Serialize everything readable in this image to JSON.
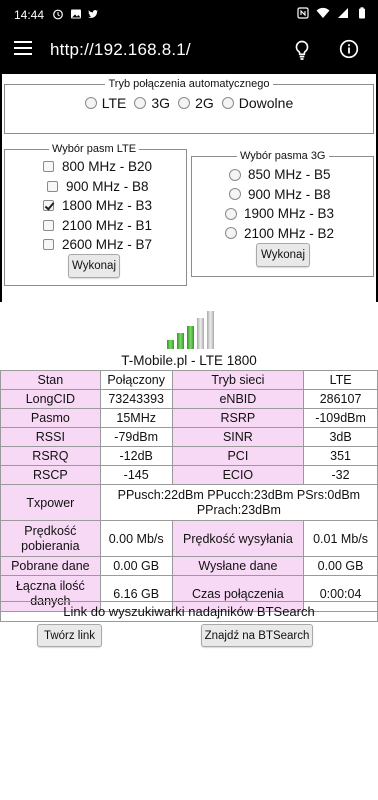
{
  "statusbar": {
    "time": "14:44",
    "left_icons": [
      "alarm-icon",
      "image-icon",
      "twitter-icon"
    ],
    "right_icons": [
      "nfc-icon",
      "wifi-icon",
      "cellular-icon",
      "battery-icon"
    ]
  },
  "toolbar": {
    "url": "http://192.168.8.1/",
    "icons": [
      "menu-icon",
      "lightbulb-icon",
      "info-icon"
    ]
  },
  "mode": {
    "legend": "Tryb połączenia automatycznego",
    "options": [
      "LTE",
      "3G",
      "2G",
      "Dowolne"
    ]
  },
  "lte_bands": {
    "legend": "Wybór pasm LTE",
    "items": [
      {
        "label": "800 MHz - B20",
        "checked": false
      },
      {
        "label": "900 MHz - B8",
        "checked": false
      },
      {
        "label": "1800 MHz - B3",
        "checked": true
      },
      {
        "label": "2100 MHz - B1",
        "checked": false
      },
      {
        "label": "2600 MHz - B7",
        "checked": false
      }
    ],
    "button": "Wykonaj"
  },
  "g3_bands": {
    "legend": "Wybór pasma 3G",
    "items": [
      "850 MHz - B5",
      "900 MHz - B8",
      "1900 MHz - B3",
      "2100 MHz - B2"
    ],
    "button": "Wykonaj"
  },
  "carrier": "T-Mobile.pl - LTE 1800",
  "signal_bars": {
    "active": 3,
    "total": 5,
    "active_color": "#3fb52e",
    "inactive_color": "#c8c8c8"
  },
  "stats": {
    "stan_label": "Stan",
    "stan_value": "Połączony",
    "tryb_label": "Tryb sieci",
    "tryb_value": "LTE",
    "longcid_label": "LongCID",
    "longcid_value": "73243393",
    "enbid_label": "eNBID",
    "enbid_value": "286107",
    "pasmo_label": "Pasmo",
    "pasmo_value": "15MHz",
    "rsrp_label": "RSRP",
    "rsrp_value": "-109dBm",
    "rssi_label": "RSSI",
    "rssi_value": "-79dBm",
    "sinr_label": "SINR",
    "sinr_value": "3dB",
    "rsrq_label": "RSRQ",
    "rsrq_value": "-12dB",
    "pci_label": "PCI",
    "pci_value": "351",
    "rscp_label": "RSCP",
    "rscp_value": "-145",
    "ecio_label": "ECIO",
    "ecio_value": "-32",
    "txpower_label": "Txpower",
    "txpower_line1": "PPusch:22dBm PPucch:23dBm PSrs:0dBm",
    "txpower_line2": "PPrach:23dBm",
    "dl_speed_label1": "Prędkość",
    "dl_speed_label2": "pobierania",
    "dl_speed_value": "0.00 Mb/s",
    "ul_speed_label": "Prędkość wysyłania",
    "ul_speed_value": "0.01 Mb/s",
    "downloaded_label": "Pobrane dane",
    "downloaded_value": "0.00 GB",
    "uploaded_label": "Wysłane dane",
    "uploaded_value": "0.00 GB",
    "total_label1": "Łączna ilość",
    "total_label2": "danych",
    "total_value": "6.16 GB",
    "time_label": "Czas połączenia",
    "time_value": "0:00:04"
  },
  "bts": {
    "link_text": "Link do wyszukiwarki nadajników BTSearch",
    "create_button": "Twórz link",
    "find_button": "Znajdź na BTSearch"
  },
  "colors": {
    "label_bg": "#f7d9f5",
    "toolbar_bg": "#000000"
  }
}
